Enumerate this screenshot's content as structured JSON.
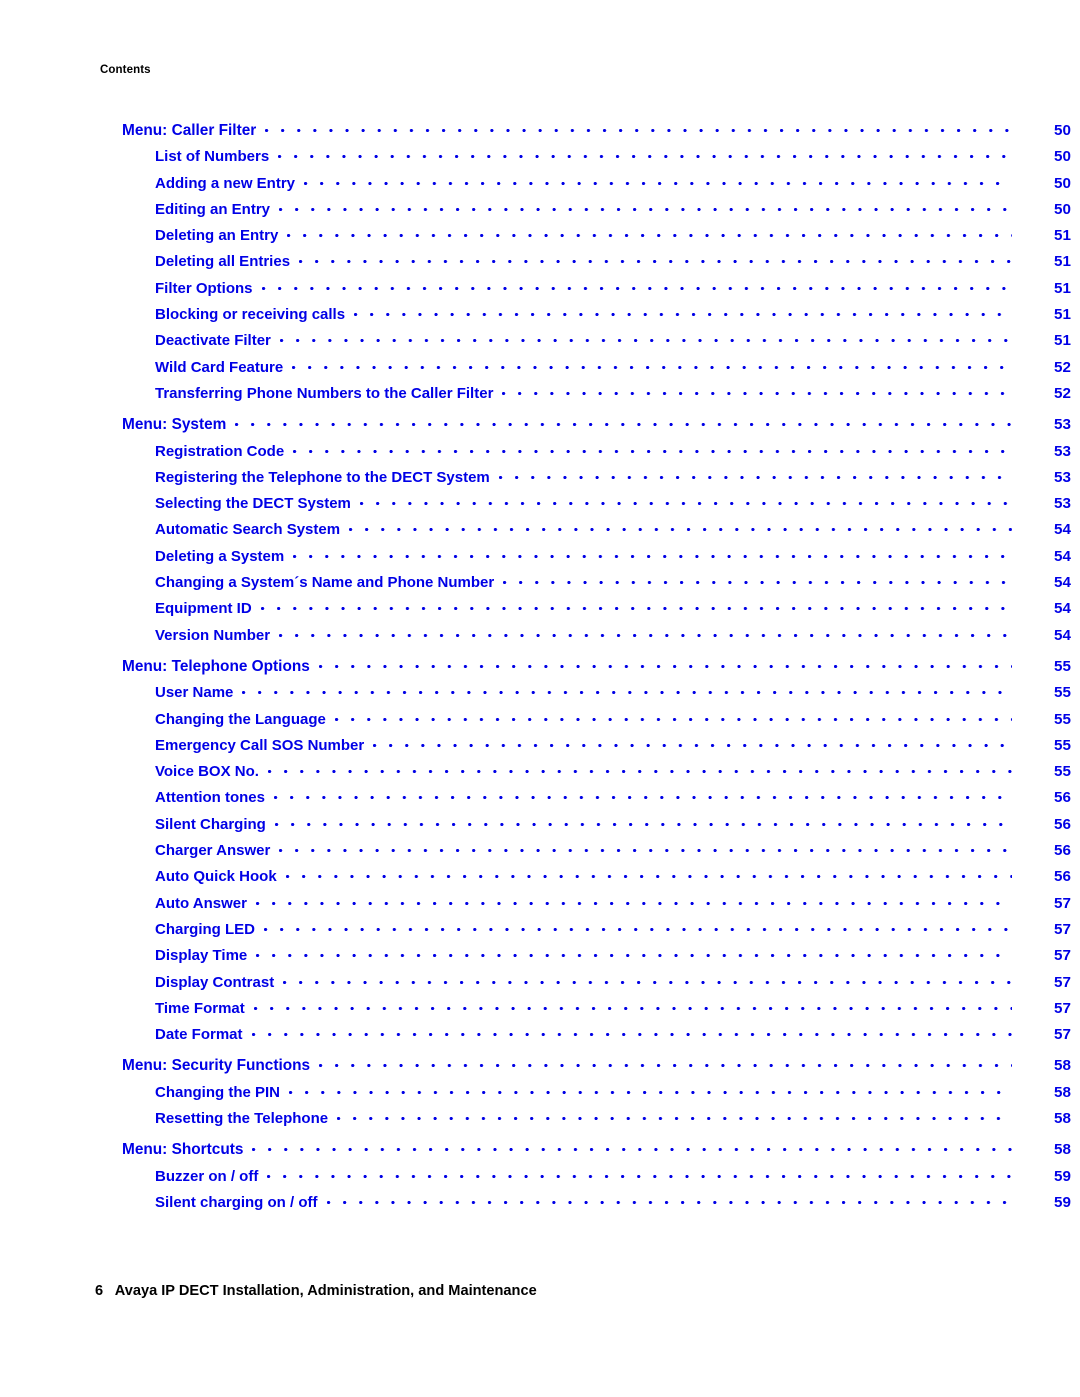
{
  "running_head": "Contents",
  "footer": "6   Avaya IP DECT Installation, Administration, and Maintenance",
  "colors": {
    "entry_blue": "#0000e6",
    "text_black": "#000000",
    "background": "#ffffff"
  },
  "toc": {
    "entries": [
      {
        "level": 1,
        "title": "Menu: Caller Filter",
        "page": "50"
      },
      {
        "level": 2,
        "title": "List of Numbers",
        "page": "50"
      },
      {
        "level": 2,
        "title": "Adding a new Entry",
        "page": "50"
      },
      {
        "level": 2,
        "title": "Editing an Entry",
        "page": "50"
      },
      {
        "level": 2,
        "title": "Deleting an Entry",
        "page": "51"
      },
      {
        "level": 2,
        "title": "Deleting all Entries",
        "page": "51"
      },
      {
        "level": 2,
        "title": "Filter Options",
        "page": "51"
      },
      {
        "level": 2,
        "title": "Blocking or receiving calls",
        "page": "51"
      },
      {
        "level": 2,
        "title": "Deactivate Filter",
        "page": "51"
      },
      {
        "level": 2,
        "title": "Wild Card Feature",
        "page": "52"
      },
      {
        "level": 2,
        "title": "Transferring Phone Numbers to the Caller Filter",
        "page": "52"
      },
      {
        "level": 1,
        "title": "Menu: System",
        "page": "53"
      },
      {
        "level": 2,
        "title": "Registration Code",
        "page": "53"
      },
      {
        "level": 2,
        "title": "Registering the Telephone to the DECT System",
        "page": "53"
      },
      {
        "level": 2,
        "title": "Selecting the DECT System",
        "page": "53"
      },
      {
        "level": 2,
        "title": "Automatic Search System",
        "page": "54"
      },
      {
        "level": 2,
        "title": "Deleting a System",
        "page": "54"
      },
      {
        "level": 2,
        "title": "Changing a System´s Name and Phone Number",
        "page": "54"
      },
      {
        "level": 2,
        "title": "Equipment ID",
        "page": "54"
      },
      {
        "level": 2,
        "title": "Version Number",
        "page": "54"
      },
      {
        "level": 1,
        "title": "Menu: Telephone Options",
        "page": "55"
      },
      {
        "level": 2,
        "title": "User Name",
        "page": "55"
      },
      {
        "level": 2,
        "title": "Changing the Language",
        "page": "55"
      },
      {
        "level": 2,
        "title": "Emergency Call SOS Number",
        "page": "55"
      },
      {
        "level": 2,
        "title": "Voice BOX No.",
        "page": "55"
      },
      {
        "level": 2,
        "title": "Attention tones",
        "page": "56"
      },
      {
        "level": 2,
        "title": "Silent Charging",
        "page": "56"
      },
      {
        "level": 2,
        "title": "Charger Answer",
        "page": "56"
      },
      {
        "level": 2,
        "title": "Auto Quick Hook",
        "page": "56"
      },
      {
        "level": 2,
        "title": "Auto Answer",
        "page": "57"
      },
      {
        "level": 2,
        "title": "Charging LED",
        "page": "57"
      },
      {
        "level": 2,
        "title": "Display Time",
        "page": "57"
      },
      {
        "level": 2,
        "title": "Display Contrast",
        "page": "57"
      },
      {
        "level": 2,
        "title": "Time Format",
        "page": "57"
      },
      {
        "level": 2,
        "title": "Date Format",
        "page": "57"
      },
      {
        "level": 1,
        "title": "Menu: Security Functions",
        "page": "58"
      },
      {
        "level": 2,
        "title": "Changing the PIN",
        "page": "58"
      },
      {
        "level": 2,
        "title": "Resetting the Telephone",
        "page": "58"
      },
      {
        "level": 1,
        "title": "Menu: Shortcuts",
        "page": "58"
      },
      {
        "level": 2,
        "title": "Buzzer on / off",
        "page": "59"
      },
      {
        "level": 2,
        "title": "Silent charging on / off",
        "page": "59"
      }
    ]
  }
}
